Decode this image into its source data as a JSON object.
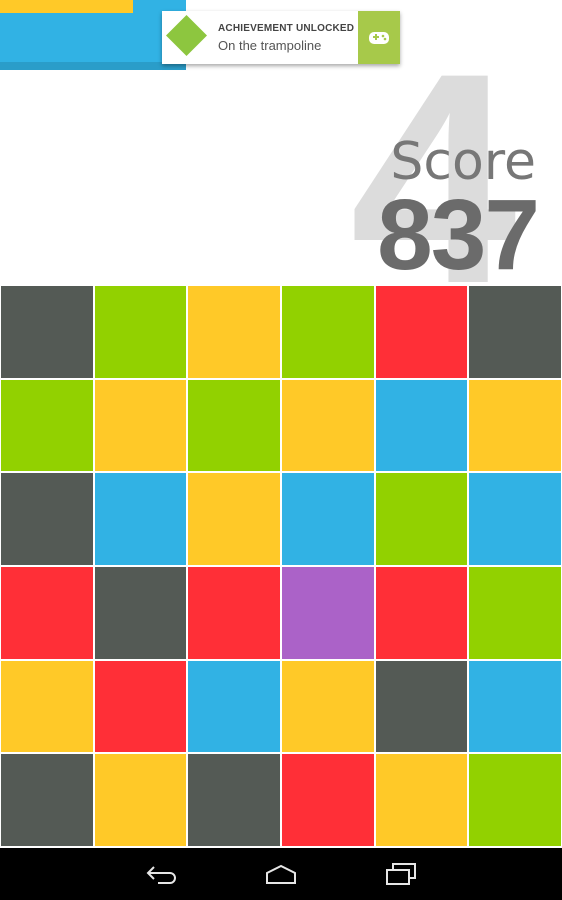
{
  "colors": {
    "gray": "#545a55",
    "green": "#92d100",
    "yellow": "#ffc928",
    "red": "#ff2f37",
    "blue": "#31b2e4",
    "purple": "#ab62c8"
  },
  "toast": {
    "title": "ACHIEVEMENT UNLOCKED",
    "subtitle": "On the trampoline",
    "badge_icon": "achievement-diamond-icon",
    "app_icon": "game-controller-icon"
  },
  "score": {
    "label": "Score",
    "value": "837",
    "level": "4"
  },
  "grid": [
    [
      "gray",
      "green",
      "yellow",
      "green",
      "red",
      "gray"
    ],
    [
      "green",
      "yellow",
      "green",
      "yellow",
      "blue",
      "yellow"
    ],
    [
      "gray",
      "blue",
      "yellow",
      "blue",
      "green",
      "blue"
    ],
    [
      "red",
      "gray",
      "red",
      "purple",
      "red",
      "green"
    ],
    [
      "yellow",
      "red",
      "blue",
      "yellow",
      "gray",
      "blue"
    ],
    [
      "gray",
      "yellow",
      "gray",
      "red",
      "yellow",
      "green"
    ]
  ],
  "navbar": {
    "back_icon": "back-icon",
    "home_icon": "home-icon",
    "recents_icon": "recents-icon"
  }
}
